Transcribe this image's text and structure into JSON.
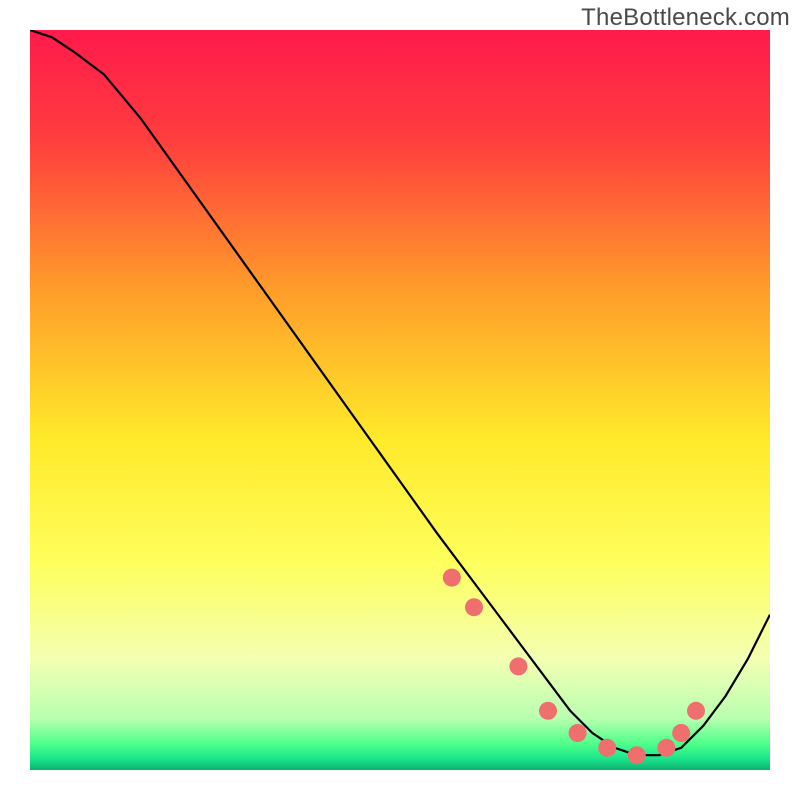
{
  "attribution": "TheBottleneck.com",
  "chart_data": {
    "type": "line",
    "title": "",
    "xlabel": "",
    "ylabel": "",
    "xlim": [
      0,
      100
    ],
    "ylim": [
      0,
      100
    ],
    "grid": false,
    "legend": false,
    "background_gradient_stops": [
      {
        "offset": 0.0,
        "color": "#ff1a4b"
      },
      {
        "offset": 0.15,
        "color": "#ff3e3e"
      },
      {
        "offset": 0.35,
        "color": "#ff9c2a"
      },
      {
        "offset": 0.55,
        "color": "#ffe92a"
      },
      {
        "offset": 0.72,
        "color": "#feff5c"
      },
      {
        "offset": 0.85,
        "color": "#f3ffb3"
      },
      {
        "offset": 0.93,
        "color": "#b9ffb0"
      },
      {
        "offset": 0.965,
        "color": "#4dff8a"
      },
      {
        "offset": 0.985,
        "color": "#19e58a"
      },
      {
        "offset": 1.0,
        "color": "#0fb06e"
      }
    ],
    "series": [
      {
        "name": "bottleneck-curve",
        "color": "#000000",
        "x": [
          0,
          3,
          6,
          10,
          15,
          20,
          25,
          30,
          35,
          40,
          45,
          50,
          55,
          58,
          61,
          64,
          67,
          70,
          73,
          76,
          79,
          82,
          85,
          88,
          91,
          94,
          97,
          100
        ],
        "y": [
          100,
          99,
          97,
          94,
          88,
          81,
          74,
          67,
          60,
          53,
          46,
          39,
          32,
          28,
          24,
          20,
          16,
          12,
          8,
          5,
          3,
          2,
          2,
          3,
          6,
          10,
          15,
          21
        ]
      }
    ],
    "markers": {
      "name": "highlight-dots",
      "color": "#ef6e6e",
      "radius_px": 9,
      "x": [
        57,
        60,
        66,
        70,
        74,
        78,
        82,
        86,
        88,
        90
      ],
      "y": [
        26,
        22,
        14,
        8,
        5,
        3,
        2,
        3,
        5,
        8
      ]
    }
  }
}
